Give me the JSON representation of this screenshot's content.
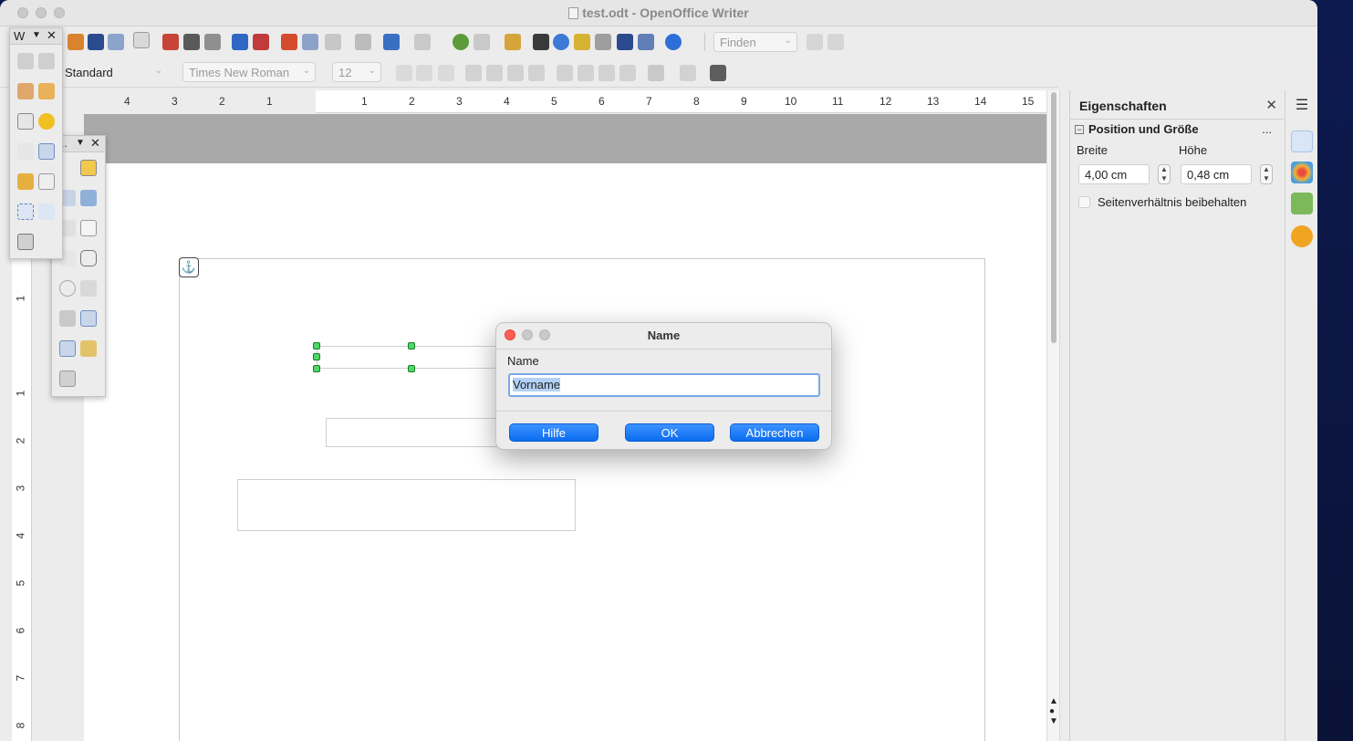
{
  "window": {
    "title": "test.odt - OpenOffice Writer"
  },
  "toolbar": {
    "find_placeholder": "Finden",
    "paragraph_style": "Standard",
    "font_name": "Times New Roman",
    "font_size": "12"
  },
  "ruler": {
    "h_left": [
      "4",
      "3",
      "2",
      "1"
    ],
    "h_right": [
      "1",
      "2",
      "3",
      "4",
      "5",
      "6",
      "7",
      "8",
      "9",
      "10",
      "11",
      "12",
      "13",
      "14",
      "15"
    ],
    "v": [
      "1",
      "1",
      "2",
      "3",
      "4",
      "5",
      "6",
      "7",
      "8"
    ]
  },
  "form_toolbar": {
    "title": "W"
  },
  "dialog": {
    "title": "Name",
    "label": "Name",
    "value": "Vorname",
    "help": "Hilfe",
    "ok": "OK",
    "cancel": "Abbrechen"
  },
  "sidebar": {
    "title": "Eigenschaften",
    "section_title": "Position und Größe",
    "more": "...",
    "width_label": "Breite",
    "height_label": "Höhe",
    "width_value": "4,00 cm",
    "height_value": "0,48 cm",
    "keep_ratio": "Seitenverhältnis beibehalten"
  },
  "colors": {
    "accent": "#0a6cf0",
    "handle": "#4cd964",
    "close": "#ff5f57",
    "desktop": "#0b1440"
  }
}
